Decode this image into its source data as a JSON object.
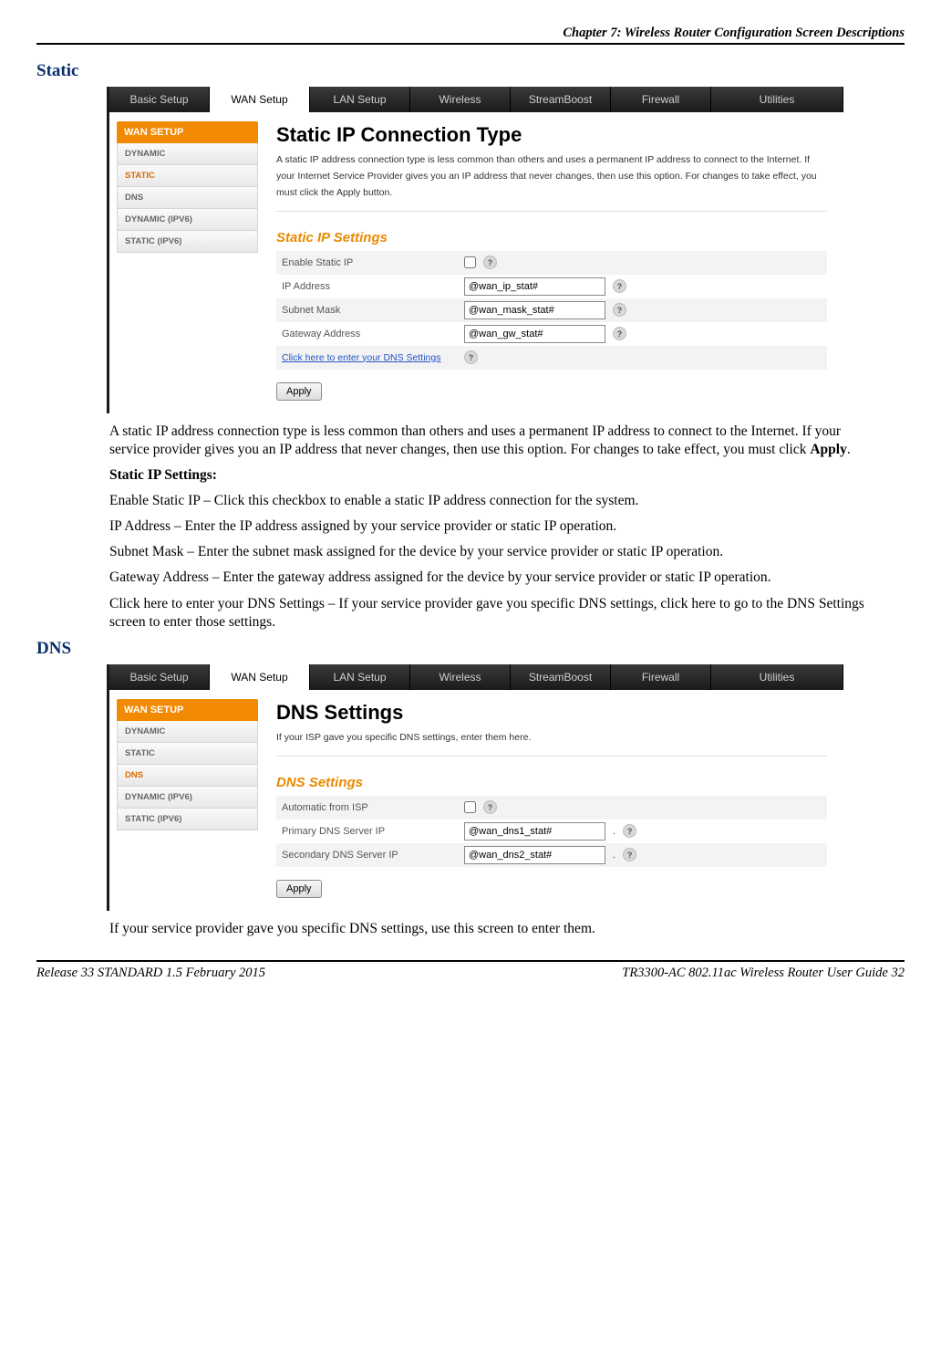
{
  "page_header": "Chapter 7: Wireless Router Configuration Screen Descriptions",
  "footer_left": "Release 33 STANDARD 1.5    February 2015",
  "footer_right": "TR3300-AC 802.11ac Wireless Router User Guide    32",
  "section1": {
    "heading": "Static",
    "router": {
      "tabs": [
        "Basic Setup",
        "WAN Setup",
        "LAN Setup",
        "Wireless",
        "StreamBoost",
        "Firewall",
        "Utilities"
      ],
      "active_tab": "WAN Setup",
      "sidebar_header": "WAN SETUP",
      "sidebar_items": [
        "DYNAMIC",
        "STATIC",
        "DNS",
        "DYNAMIC (IPV6)",
        "STATIC (IPV6)"
      ],
      "sidebar_active": "STATIC",
      "title": "Static IP Connection Type",
      "intro": "A static IP address connection type is less common than others and uses a permanent IP address to connect to the Internet. If your Internet Service Provider gives you an IP address that never changes, then use this option. For changes to take effect, you must click the Apply button.",
      "sub": "Static IP Settings",
      "rows": {
        "enable_label": "Enable Static IP",
        "ip_label": "IP Address",
        "ip_value": "@wan_ip_stat#",
        "mask_label": "Subnet Mask",
        "mask_value": "@wan_mask_stat#",
        "gw_label": "Gateway Address",
        "gw_value": "@wan_gw_stat#",
        "dns_link": "Click here to enter your DNS Settings"
      },
      "apply": "Apply"
    },
    "para1": "A static IP address connection type is less common than others and uses a permanent IP address to connect to the Internet. If your service provider gives you an IP address that never changes, then use this option. For changes to take effect, you must click ",
    "para1_bold": "Apply",
    "para1_end": ".",
    "para2_bold": "Static IP Settings:",
    "para3": "Enable Static IP – Click this checkbox to enable a static IP address connection for the system.",
    "para4": "IP Address – Enter the IP address assigned by your service provider or static IP operation.",
    "para5": "Subnet Mask – Enter the subnet mask assigned for the device by your service provider or static IP operation.",
    "para6": "Gateway Address – Enter the gateway address assigned for the device by your service provider or static IP operation.",
    "para7": "Click here to enter your DNS Settings – If your service provider gave you specific DNS settings, click here to go to the DNS Settings screen to enter those settings."
  },
  "section2": {
    "heading": "DNS",
    "router": {
      "tabs": [
        "Basic Setup",
        "WAN Setup",
        "LAN Setup",
        "Wireless",
        "StreamBoost",
        "Firewall",
        "Utilities"
      ],
      "active_tab": "WAN Setup",
      "sidebar_header": "WAN SETUP",
      "sidebar_items": [
        "DYNAMIC",
        "STATIC",
        "DNS",
        "DYNAMIC (IPV6)",
        "STATIC (IPV6)"
      ],
      "sidebar_active": "DNS",
      "title": "DNS Settings",
      "intro": "If your ISP gave you specific DNS settings, enter them here.",
      "sub": "DNS Settings",
      "rows": {
        "auto_label": "Automatic from ISP",
        "p_label": "Primary DNS Server IP",
        "p_value": "@wan_dns1_stat#",
        "s_label": "Secondary DNS Server IP",
        "s_value": "@wan_dns2_stat#"
      },
      "apply": "Apply"
    },
    "para1": "If your service provider gave you specific DNS settings, use this screen to enter them."
  }
}
